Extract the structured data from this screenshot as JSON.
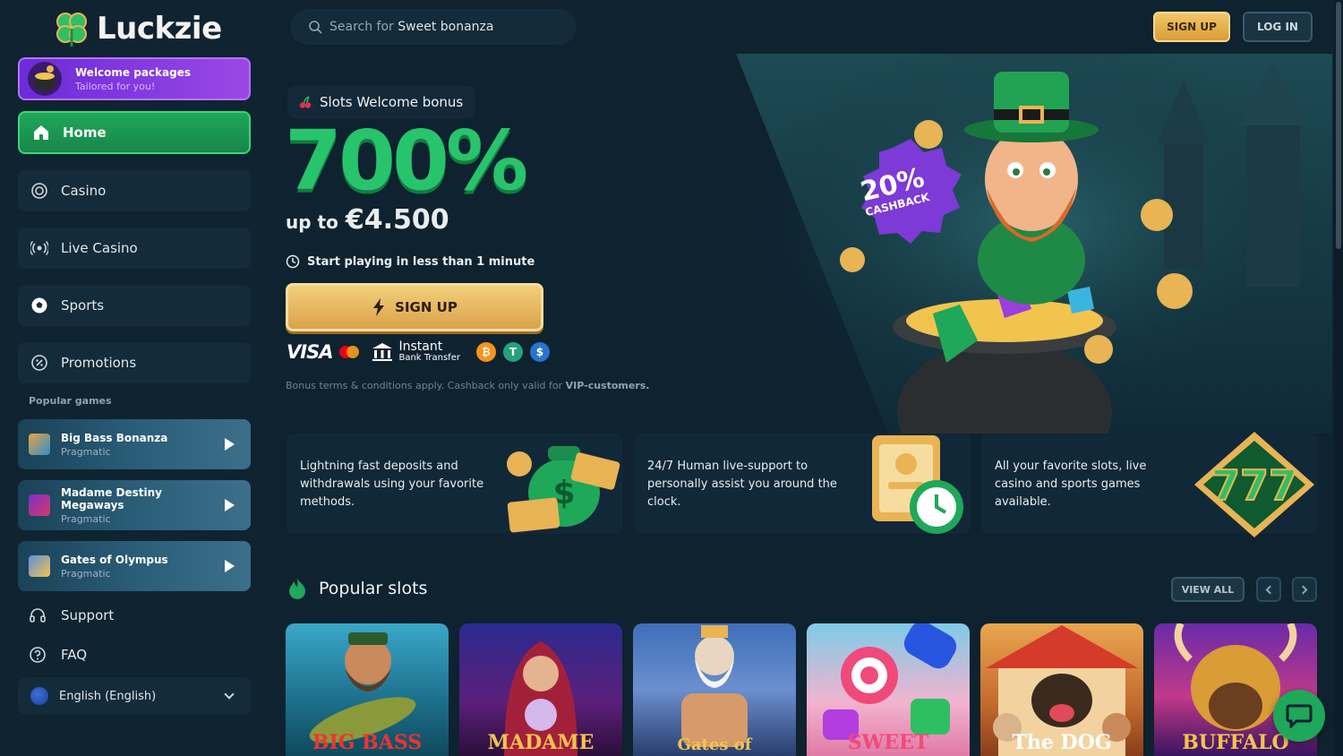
{
  "brand": {
    "name": "Luckzie"
  },
  "sidebar": {
    "welcome": {
      "title": "Welcome packages",
      "subtitle": "Tailored for you!"
    },
    "home": "Home",
    "nav": [
      {
        "label": "Casino",
        "icon": "casino-chip-icon"
      },
      {
        "label": "Live Casino",
        "icon": "live-broadcast-icon"
      },
      {
        "label": "Sports",
        "icon": "soccer-ball-icon"
      },
      {
        "label": "Promotions",
        "icon": "promo-badge-icon"
      }
    ],
    "popular_label": "Popular games",
    "popular_games": [
      {
        "name": "Big Bass Bonanza",
        "provider": "Pragmatic"
      },
      {
        "name": "Madame Destiny Megaways",
        "provider": "Pragmatic"
      },
      {
        "name": "Gates of Olympus",
        "provider": "Pragmatic"
      }
    ],
    "support": "Support",
    "faq": "FAQ",
    "language": "English (English)"
  },
  "header": {
    "search": {
      "prefix": "Search for",
      "term": "Sweet bonanza"
    },
    "signup": "SIGN UP",
    "login": "LOG IN"
  },
  "hero": {
    "tag": "Slots Welcome bonus",
    "percent": "700%",
    "upto_prefix": "up to",
    "amount": "€4.500",
    "fast_text": "Start playing in less than 1 minute",
    "cta": "SIGN UP",
    "payments": {
      "visa": "VISA",
      "instant": "Instant",
      "bank_transfer": "Bank Transfer"
    },
    "terms_prefix": "Bonus terms & conditions apply. Cashback only valid for",
    "terms_bold": "VIP-customers.",
    "cashback_pct": "20%",
    "cashback_label": "CASHBACK"
  },
  "features": [
    {
      "text": "Lightning fast deposits and withdrawals using your favorite methods."
    },
    {
      "text": "24/7 Human live-support to personally assist you around the clock."
    },
    {
      "text": "All your favorite slots, live casino and sports games available."
    }
  ],
  "popular_slots": {
    "title": "Popular slots",
    "view_all": "VIEW ALL",
    "slots": [
      {
        "title": "BIG BASS"
      },
      {
        "title": "MADAME"
      },
      {
        "title": "Gates of"
      },
      {
        "title": "SWEET"
      },
      {
        "title": "The DOG"
      },
      {
        "title": "BUFFALO"
      }
    ]
  },
  "colors": {
    "accent_green": "#27c46c",
    "gold": "#e8b454",
    "purple": "#8a3ee0",
    "bg": "#0e2230"
  }
}
